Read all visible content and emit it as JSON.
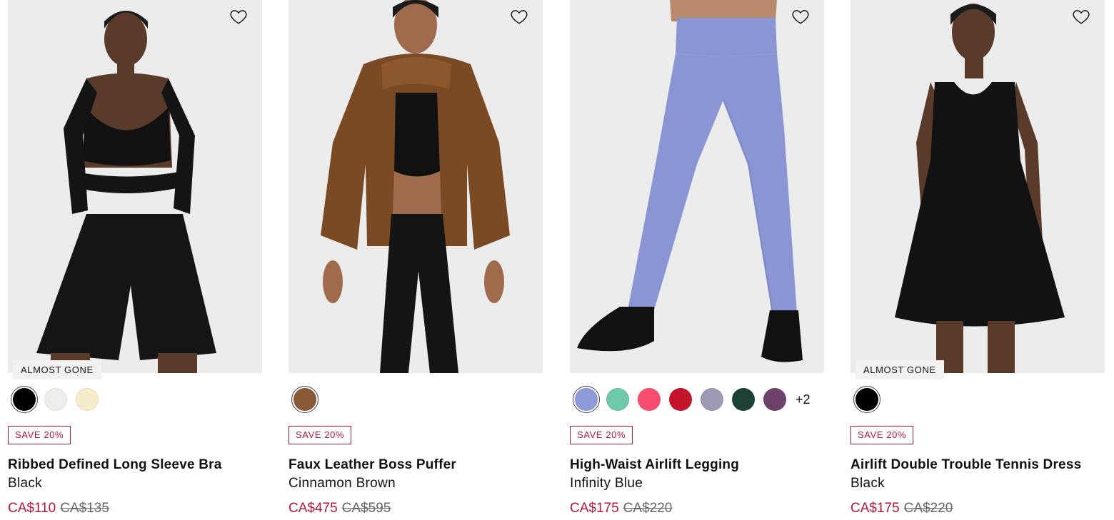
{
  "colors": {
    "sale": "#b3173a",
    "card_bg": "#ececec"
  },
  "products": [
    {
      "badge": "ALMOST GONE",
      "swatches": [
        {
          "name": "Black",
          "hex": "#000000",
          "selected": true
        },
        {
          "name": "Ivory",
          "hex": "#f0eeea",
          "selected": false
        },
        {
          "name": "Cream",
          "hex": "#f5eccc",
          "selected": false
        }
      ],
      "more": "",
      "save": "SAVE 20%",
      "name": "Ribbed Defined Long Sleeve Bra",
      "color": "Black",
      "price": "CA$110",
      "original_price": "CA$135"
    },
    {
      "badge": "",
      "swatches": [
        {
          "name": "Cinnamon Brown",
          "hex": "#8a5a37",
          "selected": true
        }
      ],
      "more": "",
      "save": "SAVE 20%",
      "name": "Faux Leather Boss Puffer",
      "color": "Cinnamon Brown",
      "price": "CA$475",
      "original_price": "CA$595"
    },
    {
      "badge": "",
      "swatches": [
        {
          "name": "Infinity Blue",
          "hex": "#8e9ad8",
          "selected": true
        },
        {
          "name": "Green",
          "hex": "#6ec9a6",
          "selected": false
        },
        {
          "name": "Pink",
          "hex": "#fa4d6f",
          "selected": false
        },
        {
          "name": "Red",
          "hex": "#c4142b",
          "selected": false
        },
        {
          "name": "Grey",
          "hex": "#9c9bb3",
          "selected": false
        },
        {
          "name": "Dark Green",
          "hex": "#1d4038",
          "selected": false
        },
        {
          "name": "Purple",
          "hex": "#6e416b",
          "selected": false
        }
      ],
      "more": "+2",
      "save": "SAVE 20%",
      "name": "High-Waist Airlift Legging",
      "color": "Infinity Blue",
      "price": "CA$175",
      "original_price": "CA$220"
    },
    {
      "badge": "ALMOST GONE",
      "swatches": [
        {
          "name": "Black",
          "hex": "#000000",
          "selected": true
        }
      ],
      "more": "",
      "save": "SAVE 20%",
      "name": "Airlift Double Trouble Tennis Dress",
      "color": "Black",
      "price": "CA$175",
      "original_price": "CA$220"
    }
  ]
}
